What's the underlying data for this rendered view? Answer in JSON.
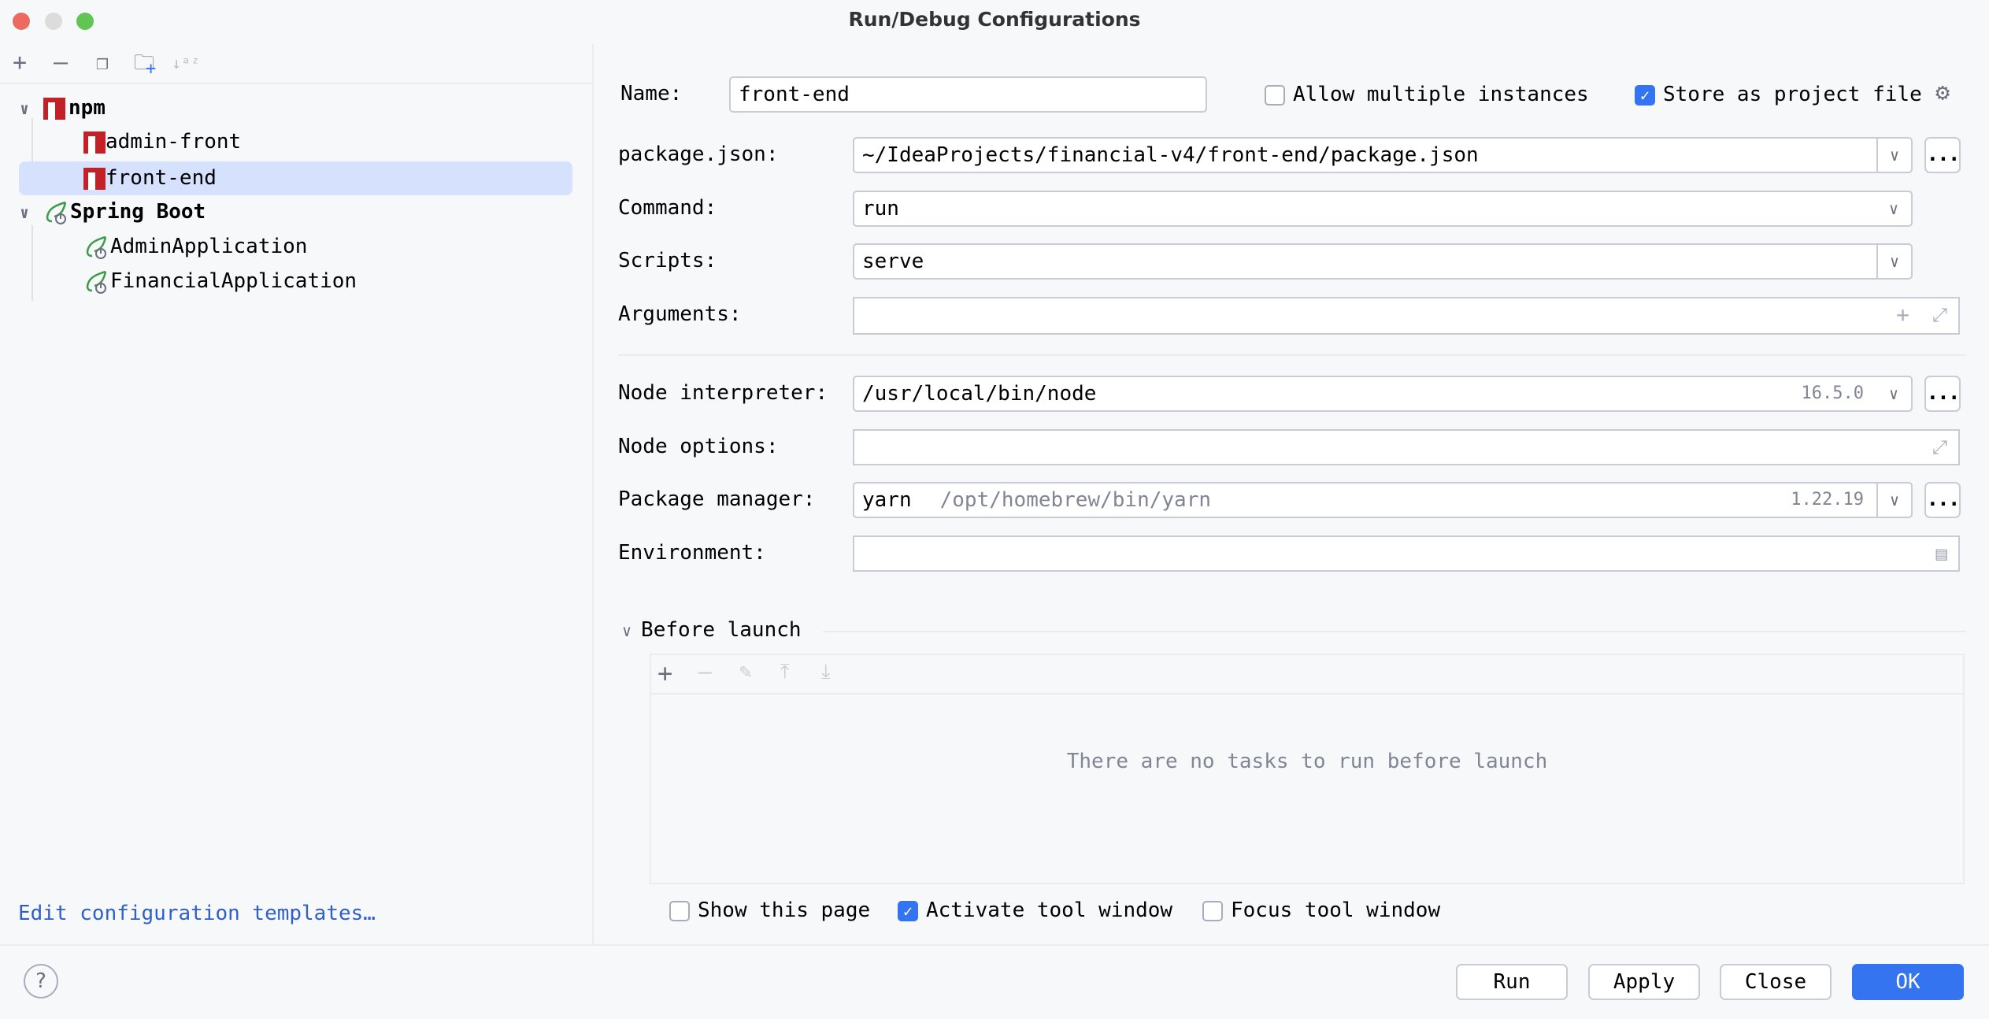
{
  "window": {
    "title": "Run/Debug Configurations"
  },
  "toolbar": {
    "add": "add-icon",
    "remove": "remove-icon",
    "copy": "copy-icon",
    "new_folder": "new-folder-icon",
    "sort": "sort-alpha-icon"
  },
  "tree": {
    "groups": [
      {
        "label": "npm",
        "items": [
          {
            "label": "admin-front"
          },
          {
            "label": "front-end",
            "selected": true
          }
        ]
      },
      {
        "label": "Spring Boot",
        "items": [
          {
            "label": "AdminApplication"
          },
          {
            "label": "FinancialApplication"
          }
        ]
      }
    ]
  },
  "edit_templates_link": "Edit configuration templates…",
  "form": {
    "name_label": "Name:",
    "name_value": "front-end",
    "allow_multiple_label": "Allow multiple instances",
    "allow_multiple_checked": false,
    "store_project_label": "Store as project file",
    "store_project_checked": true,
    "package_json_label": "package.json:",
    "package_json_value": "~/IdeaProjects/financial-v4/front-end/package.json",
    "command_label": "Command:",
    "command_value": "run",
    "scripts_label": "Scripts:",
    "scripts_value": "serve",
    "arguments_label": "Arguments:",
    "arguments_value": "",
    "node_interpreter_label": "Node interpreter:",
    "node_interpreter_value": "/usr/local/bin/node",
    "node_version": "16.5.0",
    "node_options_label": "Node options:",
    "node_options_value": "",
    "package_manager_label": "Package manager:",
    "package_manager_value": "yarn",
    "package_manager_path": "/opt/homebrew/bin/yarn",
    "package_manager_version": "1.22.19",
    "environment_label": "Environment:",
    "environment_value": "",
    "ellipsis": "..."
  },
  "before_launch": {
    "title": "Before launch",
    "empty_text": "There are no tasks to run before launch"
  },
  "options": {
    "show_page": "Show this page",
    "show_page_checked": false,
    "activate_tool": "Activate tool window",
    "activate_tool_checked": true,
    "focus_tool": "Focus tool window",
    "focus_tool_checked": false
  },
  "buttons": {
    "help": "?",
    "run": "Run",
    "apply": "Apply",
    "close": "Close",
    "ok": "OK"
  },
  "colors": {
    "accent": "#3574f0",
    "selection": "#d5e1fd",
    "npm": "#c12127",
    "spring": "#3d9c48"
  }
}
